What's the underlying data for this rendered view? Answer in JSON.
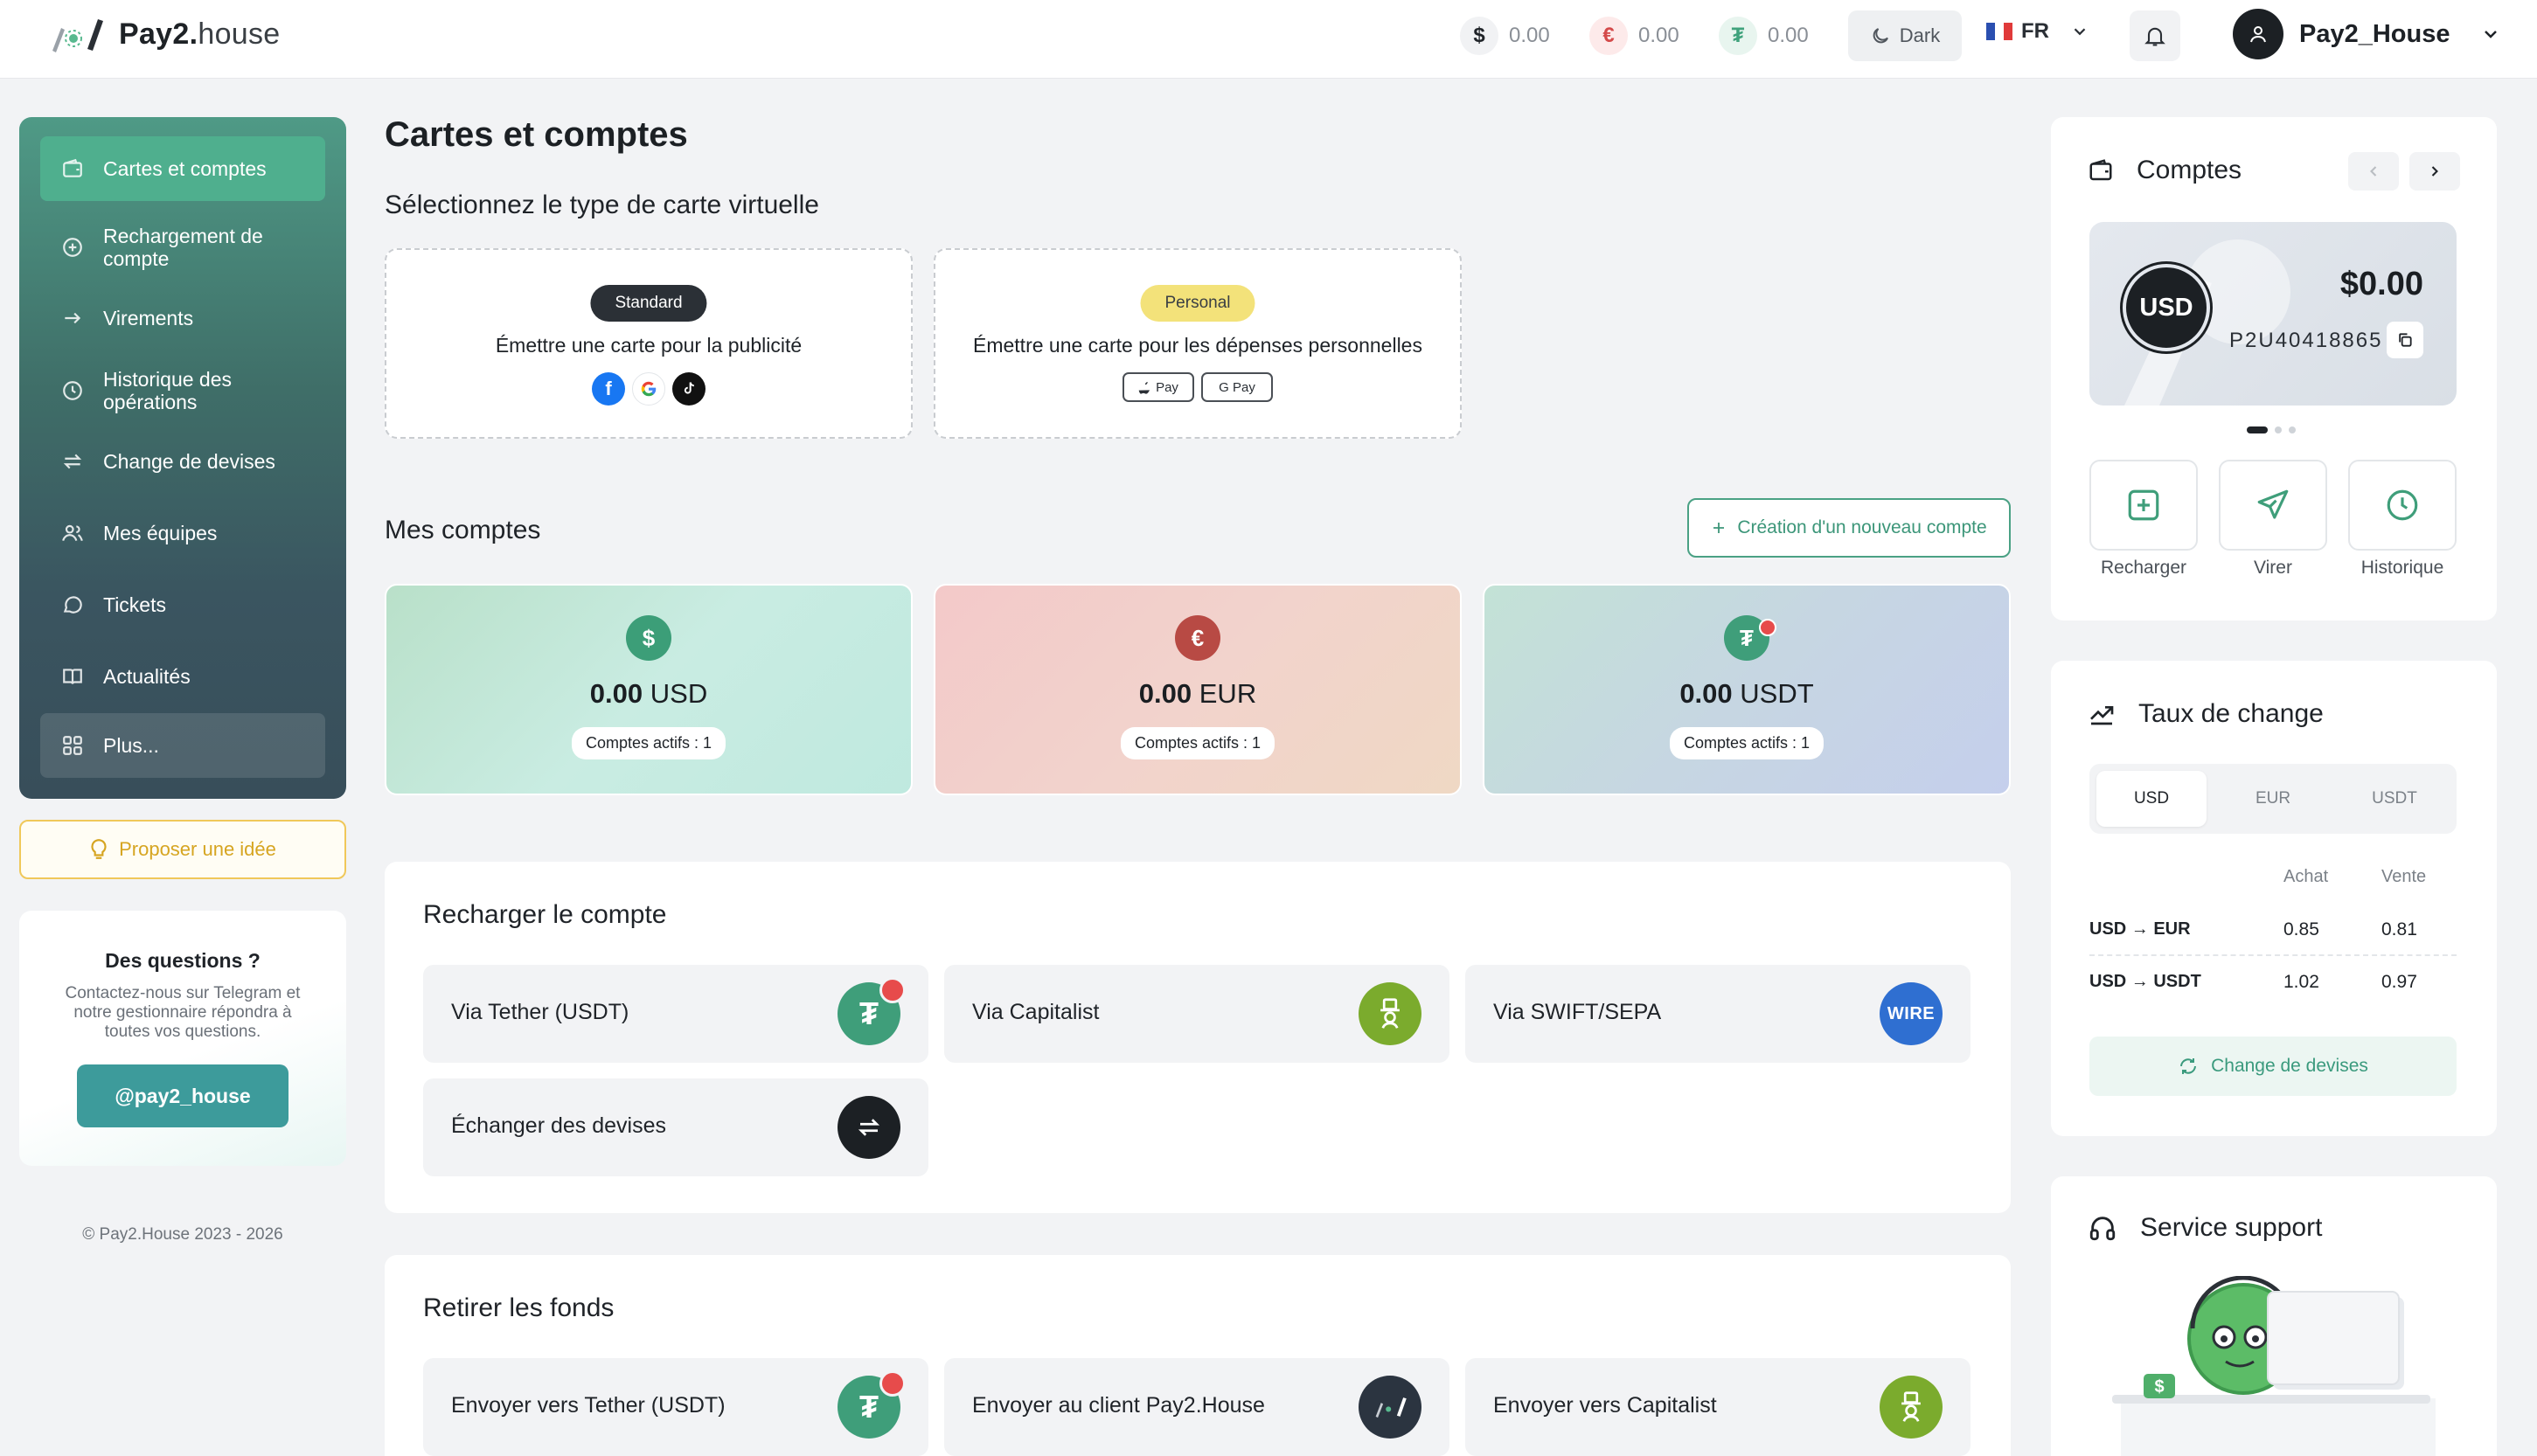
{
  "header": {
    "brand_bold": "Pay2.",
    "brand_light": "house",
    "balances": [
      {
        "symbol": "$",
        "value": "0.00",
        "icon": "dollar-icon",
        "chip_bg": "#f1f2f4",
        "chip_fg": "#1f2328"
      },
      {
        "symbol": "€",
        "value": "0.00",
        "icon": "euro-icon",
        "chip_bg": "#fdeaea",
        "chip_fg": "#d44a4a"
      },
      {
        "symbol": "₮",
        "value": "0.00",
        "icon": "tether-icon",
        "chip_bg": "#e8f5ef",
        "chip_fg": "#3fa27c"
      }
    ],
    "theme_label": "Dark",
    "lang_label": "FR",
    "user_name": "Pay2_House"
  },
  "sidebar": {
    "items": [
      {
        "label": "Cartes et comptes",
        "icon": "wallet-icon",
        "active": true
      },
      {
        "label": "Rechargement de compte",
        "icon": "plus-circle-icon"
      },
      {
        "label": "Virements",
        "icon": "arrow-right-icon"
      },
      {
        "label": "Historique des opérations",
        "icon": "clock-icon"
      },
      {
        "label": "Change de devises",
        "icon": "swap-icon"
      },
      {
        "label": "Mes équipes",
        "icon": "users-icon"
      },
      {
        "label": "Tickets",
        "icon": "chat-icon"
      },
      {
        "label": "Actualités",
        "icon": "book-icon"
      },
      {
        "label": "Plus...",
        "icon": "grid-icon"
      }
    ],
    "idea_label": "Proposer une idée",
    "help": {
      "title": "Des questions ?",
      "text": "Contactez-nous sur Telegram et notre gestionnaire répondra à toutes vos questions.",
      "button": "@pay2_house"
    },
    "copyright": "© Pay2.House 2023 - 2026"
  },
  "main": {
    "title": "Cartes et comptes",
    "card_type_heading": "Sélectionnez le type de carte virtuelle",
    "card_types": [
      {
        "badge": "Standard",
        "desc": "Émettre une carte pour la publicité",
        "badge_bg": "#2b3036",
        "badge_fg": "#ffffff"
      },
      {
        "badge": "Personal",
        "desc": "Émettre une carte pour les dépenses personnelles",
        "badge_bg": "#f3e27a",
        "badge_fg": "#3a3f44"
      }
    ],
    "pay_labels": [
      "Pay",
      "G Pay"
    ],
    "social_icons": [
      "facebook-icon",
      "google-icon",
      "tiktok-icon"
    ],
    "accounts_heading": "Mes comptes",
    "create_account_label": "Création d'un nouveau compte",
    "accounts": [
      {
        "amount": "0.00",
        "currency": "USD",
        "symbol": "$",
        "active_label": "Comptes actifs : 1",
        "icon_bg": "#3c9e78"
      },
      {
        "amount": "0.00",
        "currency": "EUR",
        "symbol": "€",
        "active_label": "Comptes actifs : 1",
        "icon_bg": "#b84a44"
      },
      {
        "amount": "0.00",
        "currency": "USDT",
        "symbol": "₮",
        "active_label": "Comptes actifs : 1",
        "icon_bg": "#3f9e7a"
      }
    ],
    "recharge": {
      "heading": "Recharger le compte",
      "tiles": [
        {
          "label": "Via Tether (USDT)",
          "icon": "tether-tron-icon"
        },
        {
          "label": "Via Capitalist",
          "icon": "capitalist-icon"
        },
        {
          "label": "Via SWIFT/SEPA",
          "icon": "wire-icon",
          "icon_text": "WIRE"
        },
        {
          "label": "Échanger des devises",
          "icon": "exchange-icon"
        }
      ]
    },
    "withdraw": {
      "heading": "Retirer les fonds",
      "tiles": [
        {
          "label": "Envoyer vers Tether (USDT)",
          "icon": "tether-tron-icon"
        },
        {
          "label": "Envoyer au client Pay2.House",
          "icon": "pay2house-icon"
        },
        {
          "label": "Envoyer vers Capitalist",
          "icon": "capitalist-icon"
        }
      ]
    }
  },
  "right": {
    "accounts_title": "Comptes",
    "card": {
      "currency": "USD",
      "balance": "$0.00",
      "number": "P2U40418865"
    },
    "actions": [
      {
        "label": "Recharger",
        "icon": "plus-square-icon"
      },
      {
        "label": "Virer",
        "icon": "send-icon"
      },
      {
        "label": "Historique",
        "icon": "clock-icon"
      }
    ],
    "rates": {
      "title": "Taux de change",
      "tabs": [
        "USD",
        "EUR",
        "USDT"
      ],
      "col_buy": "Achat",
      "col_sell": "Vente",
      "rows": [
        {
          "pair": "USD → EUR",
          "buy": "0.85",
          "sell": "0.81"
        },
        {
          "pair": "USD → USDT",
          "buy": "1.02",
          "sell": "0.97"
        }
      ],
      "exchange_label": "Change de devises"
    },
    "support_title": "Service support"
  },
  "colors": {
    "accent": "#4faf8e",
    "sidebar_dark": "#384e5a"
  }
}
